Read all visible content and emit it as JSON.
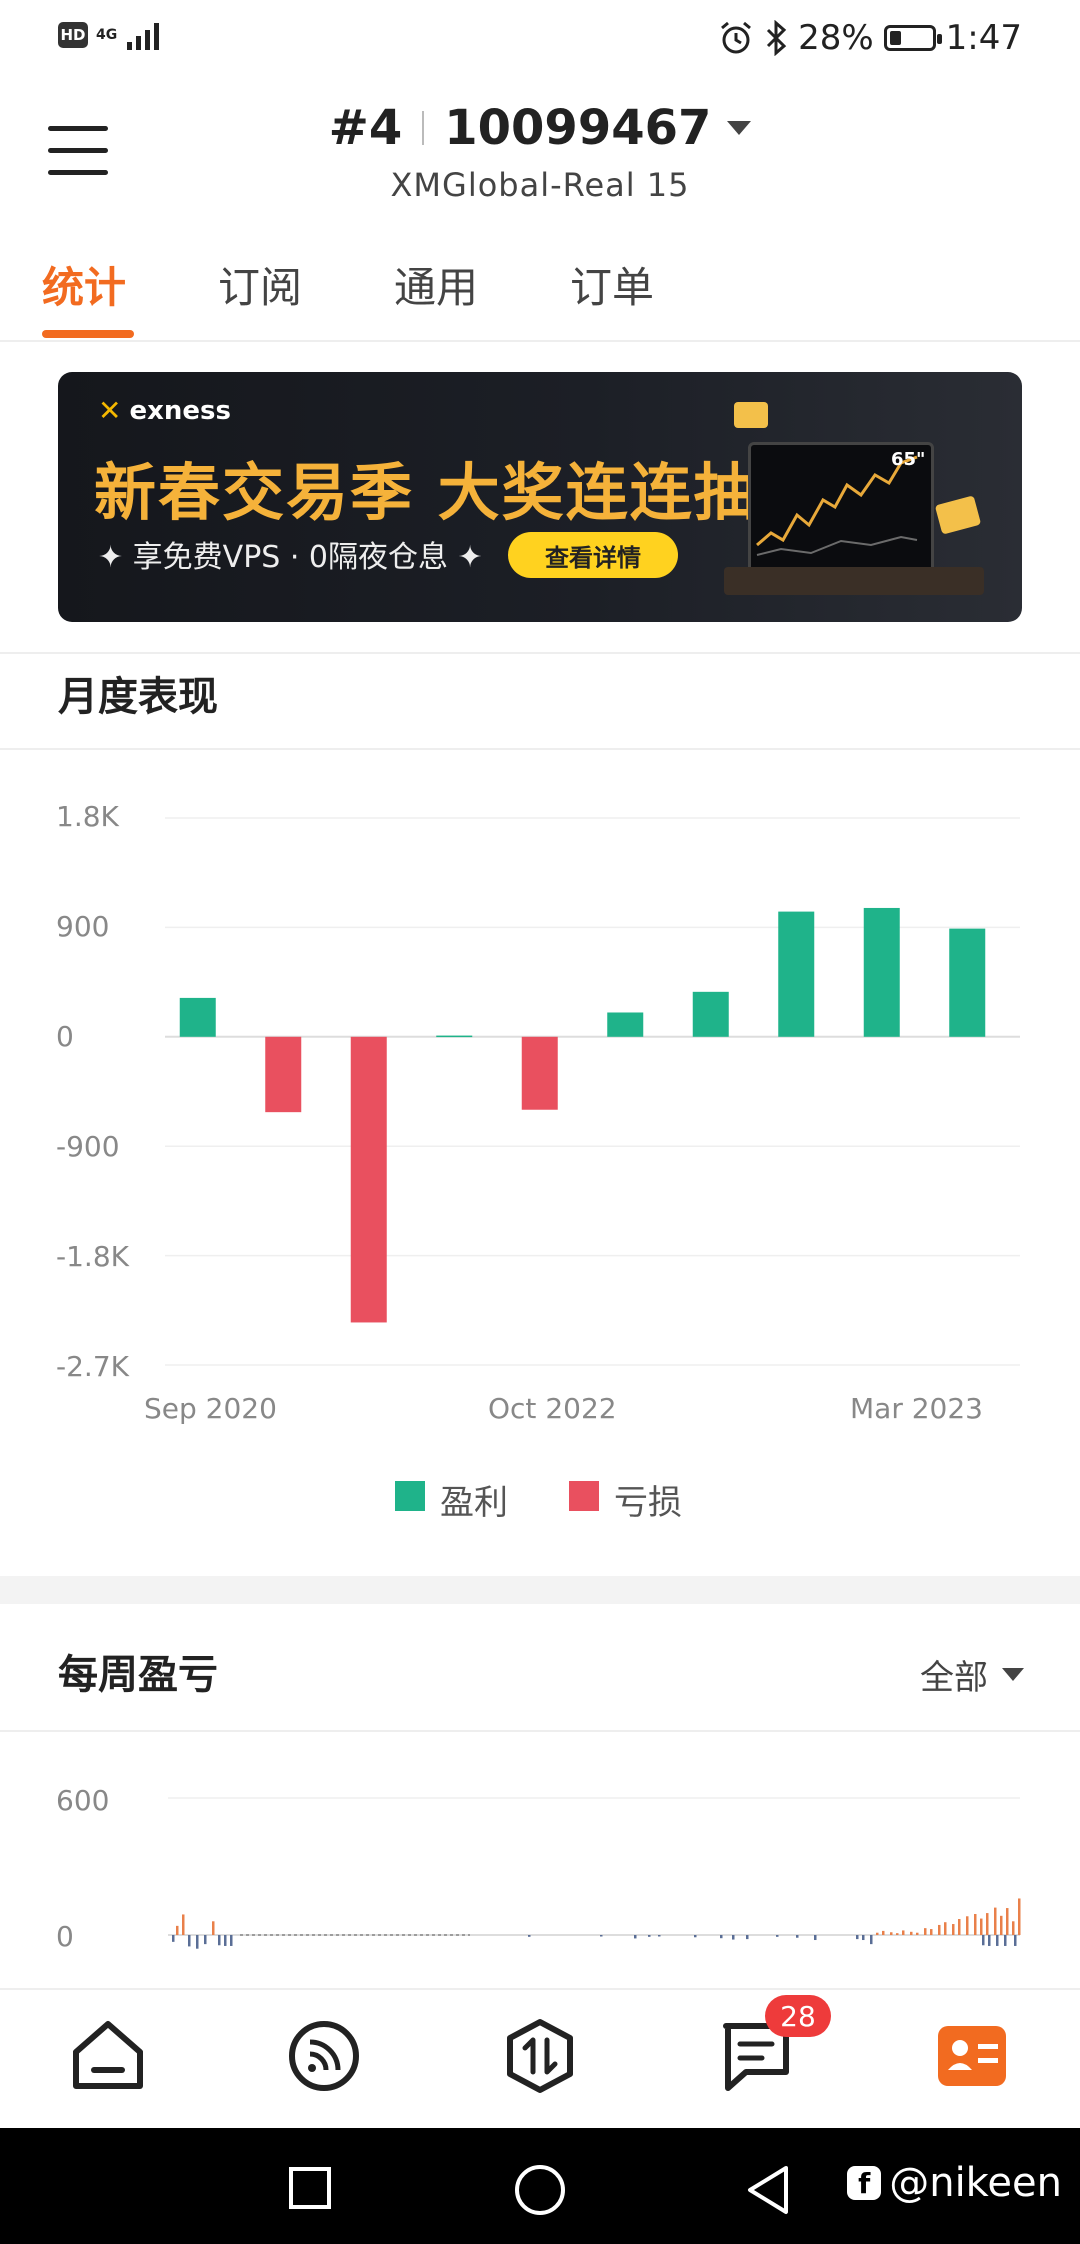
{
  "status_bar": {
    "network": "4G",
    "battery": "28%",
    "time": "1:47",
    "battery_level": 0.28
  },
  "header": {
    "account_number": "#4",
    "account_id": "10099467",
    "server": "XMGlobal-Real 15"
  },
  "tabs": [
    {
      "label": "统计",
      "active": true
    },
    {
      "label": "订阅",
      "active": false
    },
    {
      "label": "通用",
      "active": false
    },
    {
      "label": "订单",
      "active": false
    }
  ],
  "banner": {
    "brand": "exness",
    "headline": "新春交易季 大奖连连抽",
    "subline": "✦ 享免费VPS · 0隔夜仓息 ✦",
    "cta": "查看详情",
    "tv_label": "65\""
  },
  "monthly": {
    "title": "月度表现",
    "legend_profit": "盈利",
    "legend_loss": "亏损",
    "colors": {
      "profit": "#1fb38a",
      "loss": "#e9505f"
    }
  },
  "chart_data": [
    {
      "type": "bar",
      "title": "月度表现",
      "x_tick_labels": [
        "Sep 2020",
        "Oct 2022",
        "Mar 2023"
      ],
      "y_tick_labels": [
        "1.8K",
        "900",
        "0",
        "-900",
        "-1.8K",
        "-2.7K"
      ],
      "ylim": [
        -2700,
        1800
      ],
      "values": [
        320,
        -620,
        -2350,
        10,
        -600,
        200,
        370,
        1030,
        1060,
        890
      ],
      "series": [
        {
          "name": "盈利"
        },
        {
          "name": "亏损"
        }
      ],
      "grid": true,
      "legend": "bottom-center"
    },
    {
      "type": "bar",
      "title": "每周盈亏",
      "y_tick_labels": [
        "600",
        "0"
      ],
      "ylim": [
        0,
        600
      ],
      "filter": "全部"
    }
  ],
  "weekly": {
    "title": "每周盈亏",
    "filter": "全部"
  },
  "bottom_nav": [
    {
      "icon": "home-icon"
    },
    {
      "icon": "feed-icon"
    },
    {
      "icon": "trade-icon"
    },
    {
      "icon": "messages-icon",
      "badge": "28"
    },
    {
      "icon": "profile-card-icon",
      "active": true
    }
  ],
  "watermark": "@nikeen"
}
